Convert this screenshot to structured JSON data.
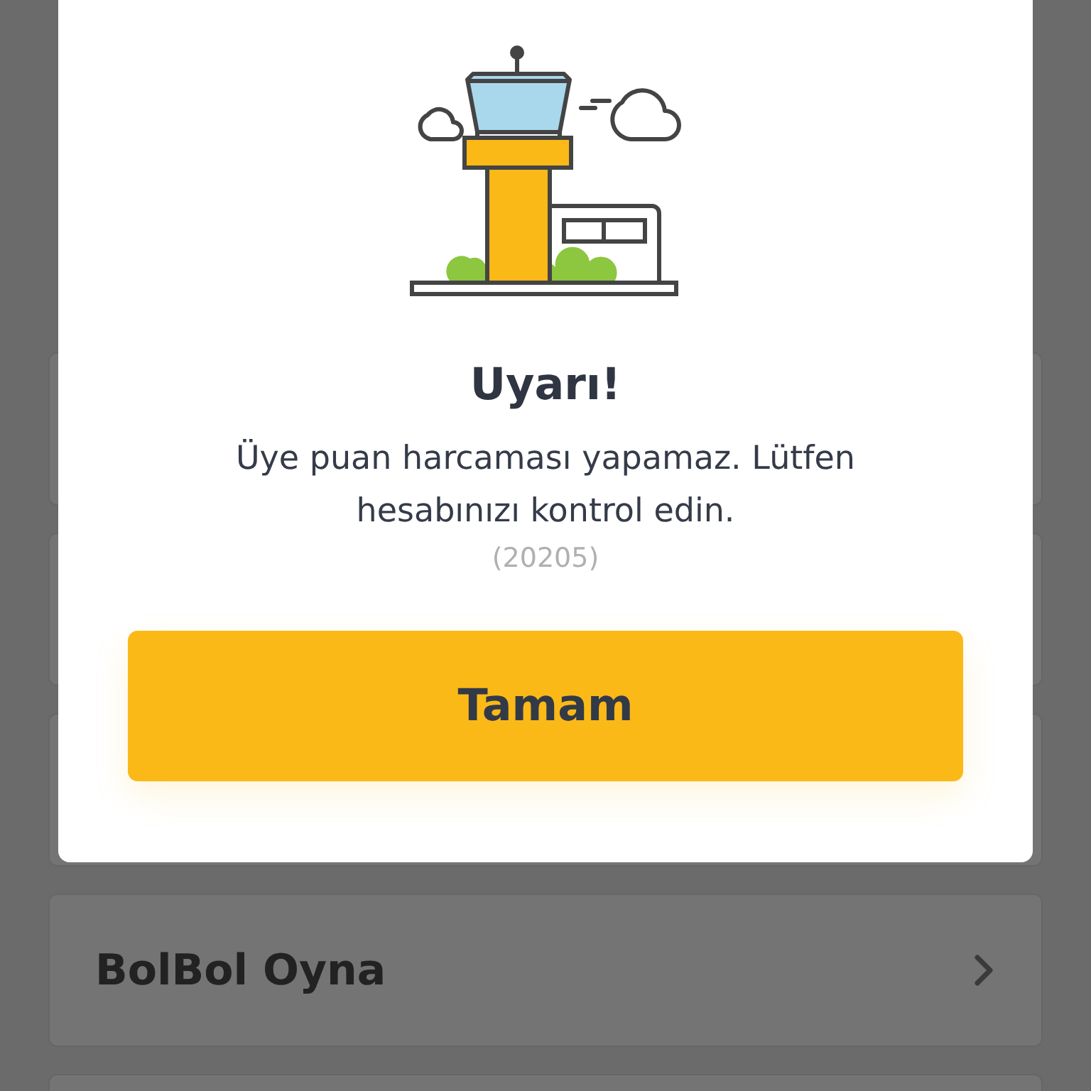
{
  "background_list": {
    "items": [
      {
        "kind": "blank"
      },
      {
        "kind": "blank"
      },
      {
        "kind": "blank"
      },
      {
        "kind": "entry",
        "label": "BolBol Oyna"
      },
      {
        "kind": "blank"
      }
    ]
  },
  "dialog": {
    "title": "Uyarı!",
    "message": "Üye puan harcaması yapamaz. Lütfen hesabınızı kontrol edin.",
    "code": "(20205)",
    "button": "Tamam"
  }
}
